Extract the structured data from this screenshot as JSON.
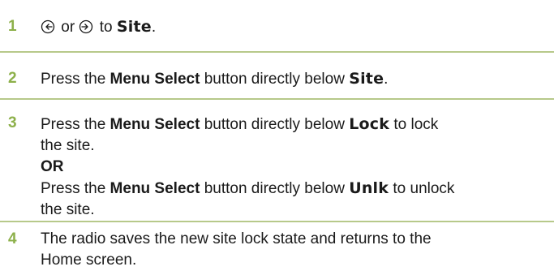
{
  "steps": [
    {
      "number": "1",
      "left_icon": "navigate-left-icon",
      "or_text": "or",
      "right_icon": "navigate-right-icon",
      "to_text": "to",
      "display_word": "Site",
      "end_punct": "."
    },
    {
      "number": "2",
      "pre": "Press the",
      "button_name": "Menu Select",
      "post": "button directly below",
      "display_word": "Site",
      "end_punct": "."
    },
    {
      "number": "3",
      "a_pre": "Press the",
      "a_button_name": "Menu Select",
      "a_post": "button directly below",
      "a_display_word": "Lock",
      "a_suffix": "to lock",
      "a_line2": "the site.",
      "or_label": "OR",
      "b_pre": "Press the",
      "b_button_name": "Menu Select",
      "b_post": "button directly below",
      "b_display_word": "Unlk",
      "b_suffix": "to unlock",
      "b_line2": "the site."
    },
    {
      "number": "4",
      "line1": "The radio saves the new site lock state and returns to the",
      "line2": "Home screen."
    }
  ],
  "colors": {
    "step_number": "#8db04a",
    "divider": "#b7c98a",
    "text": "#1a1a1a"
  }
}
